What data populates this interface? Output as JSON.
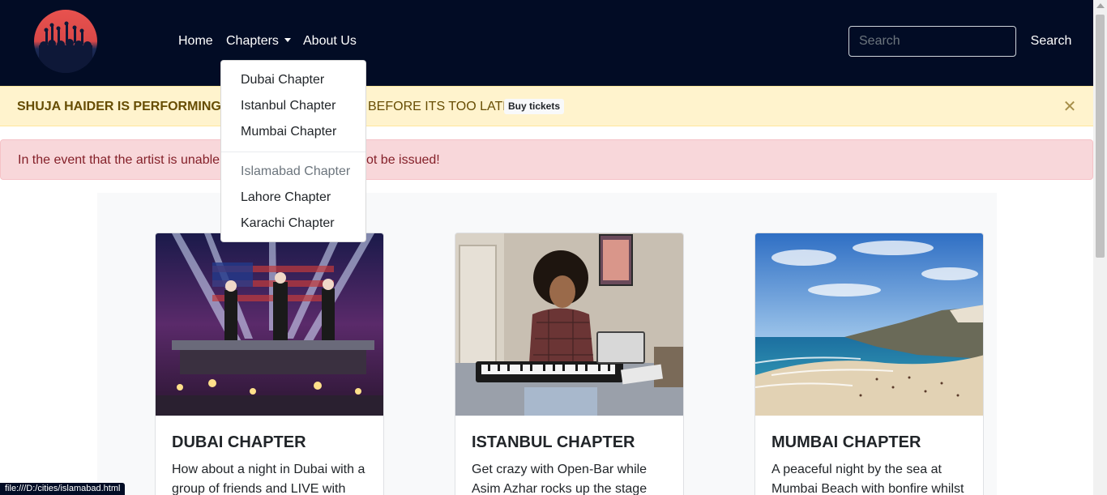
{
  "nav": {
    "logo_icon": "concert-crowd-logo",
    "home": "Home",
    "chapters": "Chapters",
    "about": "About Us",
    "search_placeholder": "Search",
    "search_button": "Search"
  },
  "dropdown": {
    "items": [
      {
        "label": "Dubai Chapter",
        "disabled": false
      },
      {
        "label": "Istanbul Chapter",
        "disabled": false
      },
      {
        "label": "Mumbai Chapter",
        "disabled": false
      },
      {
        "label": "Islamabad Chapter",
        "disabled": true
      },
      {
        "label": "Lahore Chapter",
        "disabled": false
      },
      {
        "label": "Karachi Chapter",
        "disabled": false
      }
    ]
  },
  "alerts": {
    "warning_left": "SHUJA HAIDER IS PERFORMING L",
    "warning_right": "BEFORE ITS TOO LATE!!",
    "warning_badge": "Buy tickets",
    "close_icon": "close-icon",
    "danger_left": "In the event that the artist is unable",
    "danger_right": "ot be issued!"
  },
  "cards": [
    {
      "title": "DUBAI CHAPTER",
      "text": "How about a night in Dubai with a group of friends and LIVE with",
      "image": "rock-band-concert-photo"
    },
    {
      "title": "ISTANBUL CHAPTER",
      "text": "Get crazy with Open-Bar while Asim Azhar rocks up the stage",
      "image": "woman-playing-keyboard-photo"
    },
    {
      "title": "MUMBAI CHAPTER",
      "text": "A peaceful night by the sea at Mumbai Beach with bonfire whilst",
      "image": "beach-coastline-photo"
    }
  ],
  "statusbar": "file:///D:/cities/islamabad.html"
}
